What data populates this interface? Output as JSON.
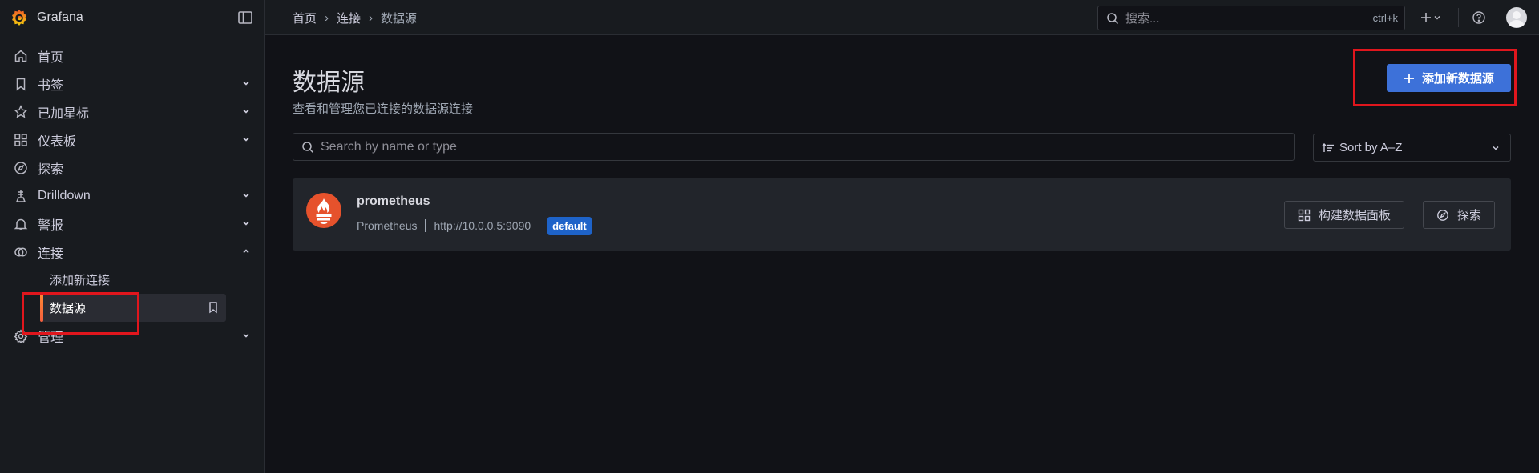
{
  "app": {
    "name": "Grafana"
  },
  "sidebar": {
    "items": [
      {
        "label": "首页",
        "icon": "home-icon",
        "expandable": false
      },
      {
        "label": "书签",
        "icon": "bookmark-icon",
        "expandable": true
      },
      {
        "label": "已加星标",
        "icon": "star-icon",
        "expandable": true
      },
      {
        "label": "仪表板",
        "icon": "apps-icon",
        "expandable": true
      },
      {
        "label": "探索",
        "icon": "compass-icon",
        "expandable": false
      },
      {
        "label": "Drilldown",
        "icon": "drilldown-icon",
        "expandable": true
      },
      {
        "label": "警报",
        "icon": "bell-icon",
        "expandable": true
      },
      {
        "label": "连接",
        "icon": "link-icon",
        "expandable": true,
        "expanded": true
      },
      {
        "label": "管理",
        "icon": "cog-icon",
        "expandable": true
      }
    ],
    "connections_children": [
      {
        "label": "添加新连接"
      },
      {
        "label": "数据源",
        "active": true
      }
    ]
  },
  "breadcrumb": [
    "首页",
    "连接",
    "数据源"
  ],
  "search": {
    "placeholder": "搜索...",
    "shortcut": "ctrl+k"
  },
  "page": {
    "title": "数据源",
    "subtitle": "查看和管理您已连接的数据源连接",
    "add_button": "添加新数据源",
    "filter_placeholder": "Search by name or type",
    "sort_label": "Sort by A–Z"
  },
  "datasources": [
    {
      "name": "prometheus",
      "type": "Prometheus",
      "url": "http://10.0.0.5:9090",
      "badge": "default",
      "actions": [
        "构建数据面板",
        "探索"
      ]
    }
  ],
  "colors": {
    "accent": "#3d71d9",
    "highlight": "#e0161d",
    "prometheus": "#e6522c",
    "active_bar": "#ff8833"
  }
}
